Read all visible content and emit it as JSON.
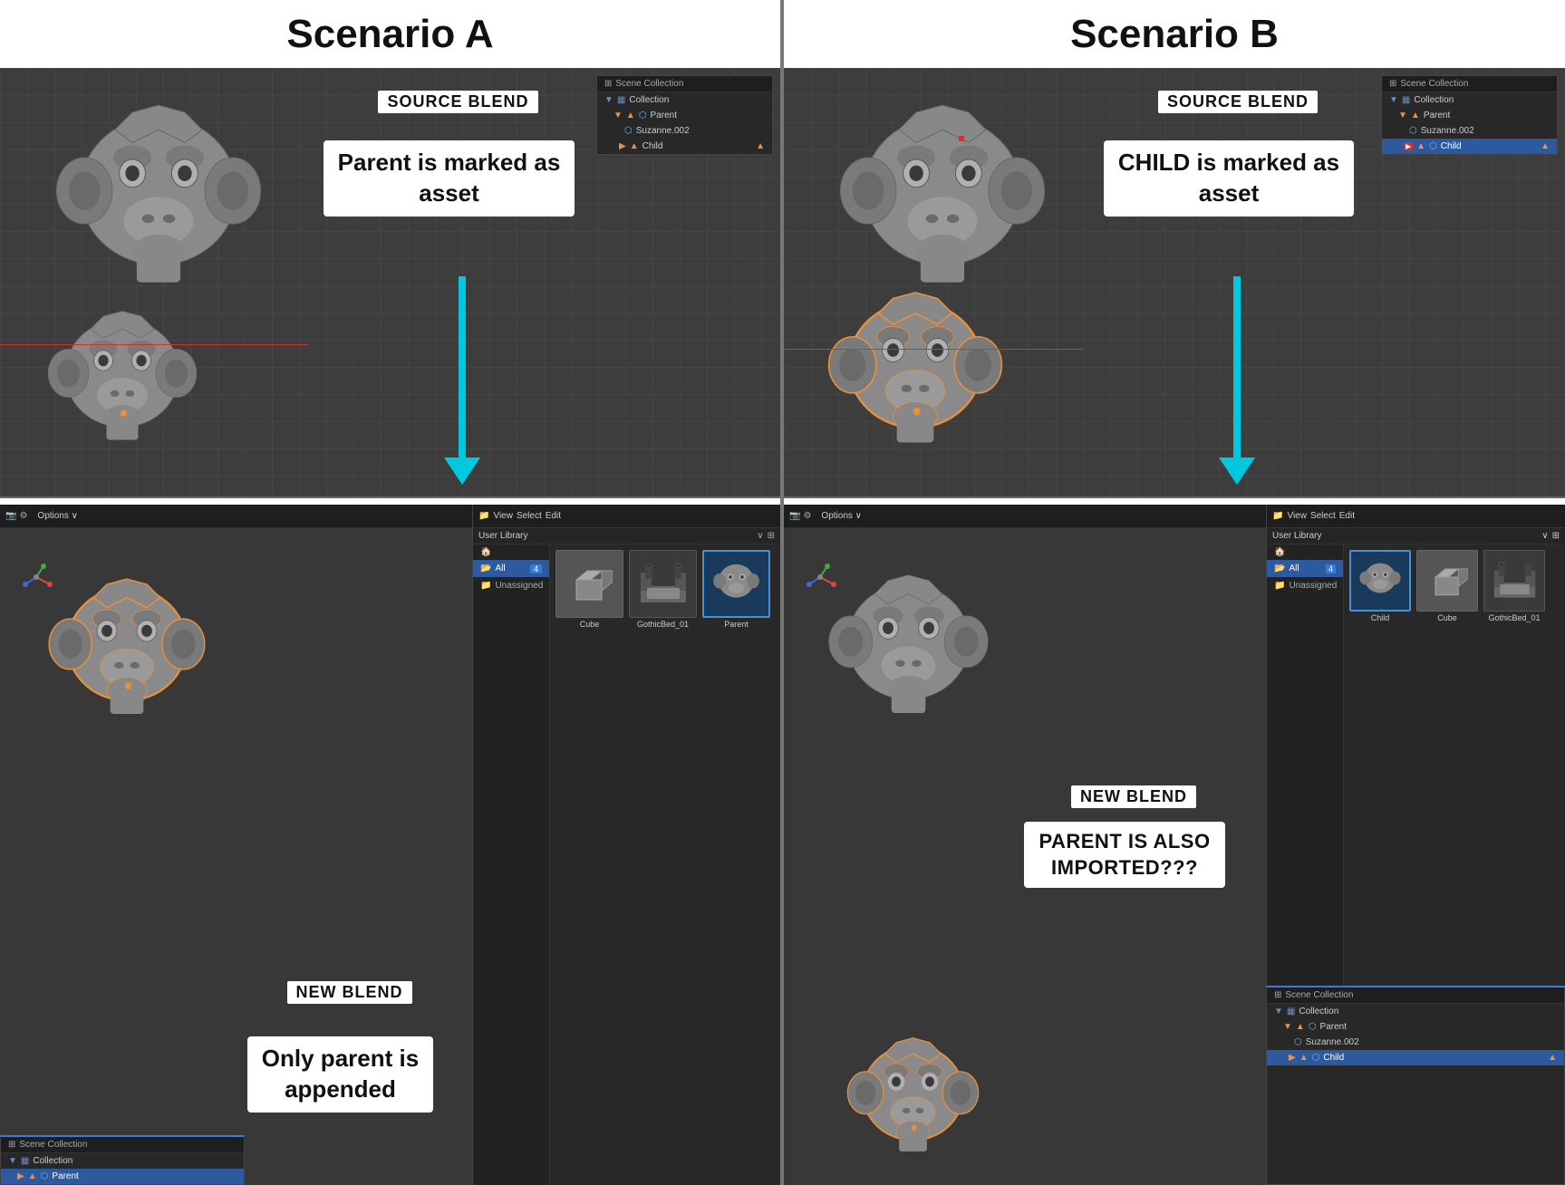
{
  "scenarios": {
    "a": {
      "title": "Scenario A",
      "source_blend_label": "SOURCE BLEND",
      "asset_description": "Parent is marked as\nasset",
      "new_blend_label": "NEW BLEND",
      "appended_description": "Only parent is\nappended",
      "outliner_top": {
        "header": "Scene Collection",
        "items": [
          {
            "label": "Collection",
            "indent": 0,
            "type": "collection"
          },
          {
            "label": "Parent",
            "indent": 1,
            "type": "parent",
            "icon": "triangle+mesh"
          },
          {
            "label": "Suzanne.002",
            "indent": 2,
            "type": "mesh"
          },
          {
            "label": "Child",
            "indent": 2,
            "type": "child",
            "icon": "triangle"
          }
        ]
      },
      "outliner_bottom": {
        "header": "Scene Collection",
        "items": [
          {
            "label": "Collection",
            "indent": 0,
            "type": "collection"
          },
          {
            "label": "Parent",
            "indent": 1,
            "type": "parent",
            "selected": true
          }
        ]
      },
      "asset_browser": {
        "library": "User Library",
        "nav": [
          "All",
          "Unassigned"
        ],
        "active_nav": "All",
        "assets": [
          {
            "label": "Cube",
            "type": "cube"
          },
          {
            "label": "GothicBed_01",
            "type": "bed"
          },
          {
            "label": "Parent",
            "type": "parent",
            "selected": true
          }
        ]
      }
    },
    "b": {
      "title": "Scenario B",
      "source_blend_label": "SOURCE BLEND",
      "asset_description": "CHILD is marked as\nasset",
      "new_blend_label": "NEW BLEND",
      "appended_description": "PARENT IS ALSO\nIMPORTED???",
      "outliner_top": {
        "header": "Scene Collection",
        "items": [
          {
            "label": "Collection",
            "indent": 0,
            "type": "collection"
          },
          {
            "label": "Parent",
            "indent": 1,
            "type": "parent"
          },
          {
            "label": "Suzanne.002",
            "indent": 2,
            "type": "mesh"
          },
          {
            "label": "Child",
            "indent": 2,
            "type": "child",
            "selected": true,
            "icon": "triangle"
          }
        ]
      },
      "outliner_bottom": {
        "header": "Scene Collection",
        "items": [
          {
            "label": "Collection",
            "indent": 0,
            "type": "collection"
          },
          {
            "label": "Parent",
            "indent": 1,
            "type": "parent"
          },
          {
            "label": "Suzanne.002",
            "indent": 2,
            "type": "mesh"
          },
          {
            "label": "Child",
            "indent": 2,
            "type": "child",
            "selected": true
          }
        ]
      },
      "asset_browser": {
        "library": "User Library",
        "nav": [
          "All",
          "Unassigned"
        ],
        "active_nav": "All",
        "assets": [
          {
            "label": "Child",
            "type": "child",
            "selected": true
          },
          {
            "label": "Cube",
            "type": "cube"
          },
          {
            "label": "GothicBed_01",
            "type": "bed"
          }
        ]
      }
    }
  },
  "arrow": {
    "color": "#00c8e0"
  },
  "divider_color": "#666"
}
